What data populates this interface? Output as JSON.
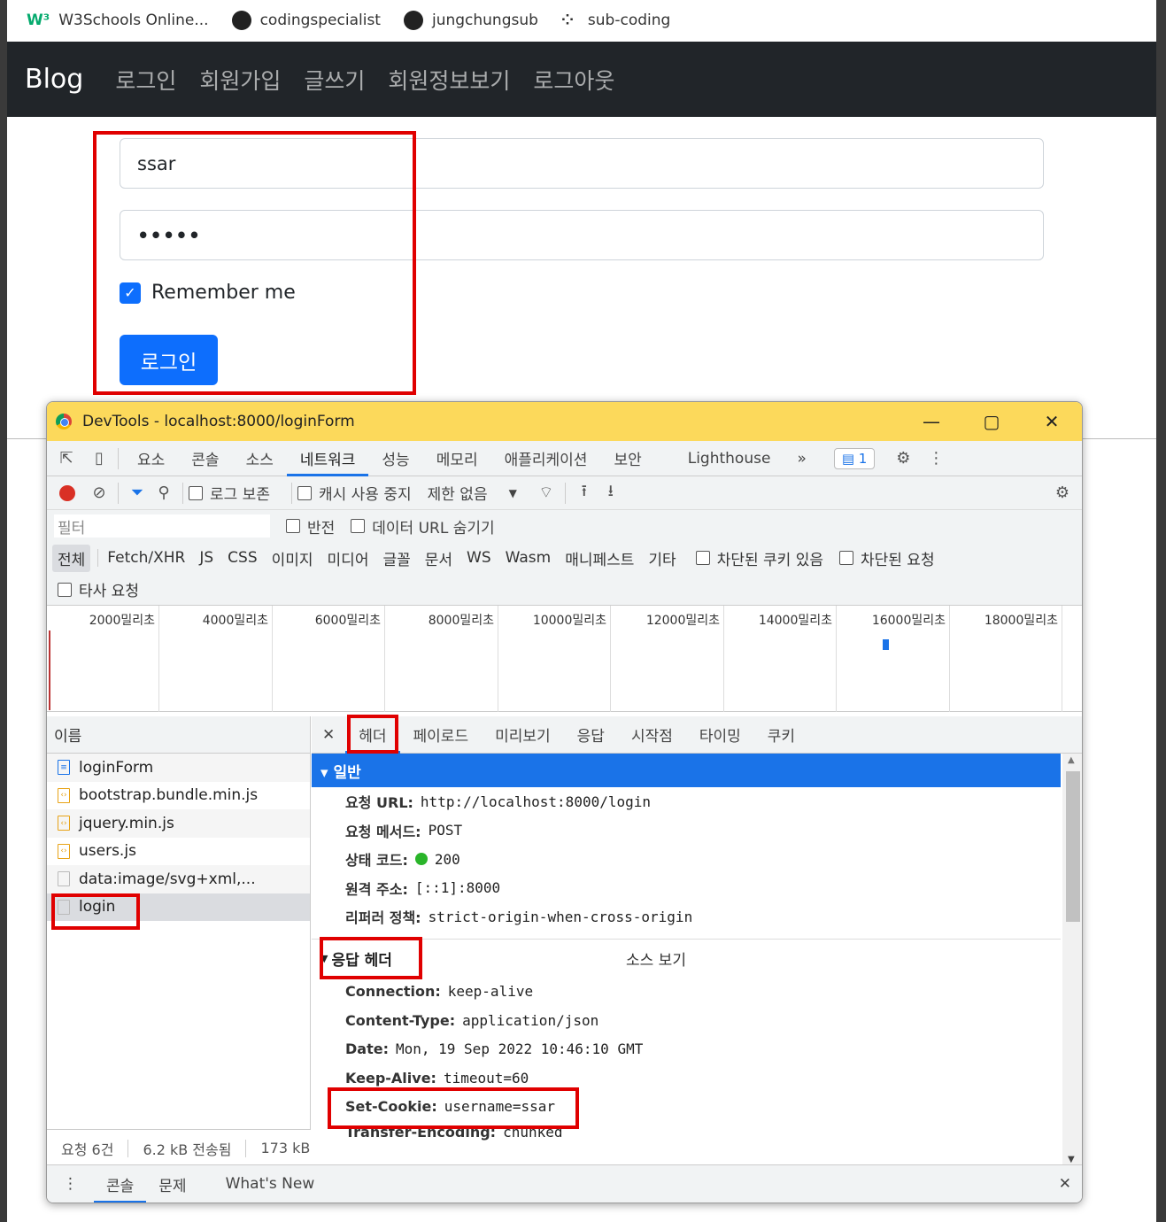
{
  "bookmarks": [
    {
      "label": "W3Schools Online...",
      "icon": "w3schools-icon"
    },
    {
      "label": "codingspecialist",
      "icon": "github-icon"
    },
    {
      "label": "jungchungsub",
      "icon": "github-icon"
    },
    {
      "label": "sub-coding",
      "icon": "linktree-icon"
    }
  ],
  "navbar": {
    "brand": "Blog",
    "links": [
      "로그인",
      "회원가입",
      "글쓰기",
      "회원정보보기",
      "로그아웃"
    ]
  },
  "login_form": {
    "username_value": "ssar",
    "password_value": "•••••",
    "remember_label": "Remember me",
    "remember_checked": true,
    "submit_label": "로그인"
  },
  "devtools": {
    "title": "DevTools - localhost:8000/loginForm",
    "tabs": [
      "요소",
      "콘솔",
      "소스",
      "네트워크",
      "성능",
      "메모리",
      "애플리케이션",
      "보안",
      "Lighthouse"
    ],
    "active_tab": "네트워크",
    "message_count": "1",
    "toolbar": {
      "preserve_log": "로그 보존",
      "disable_cache": "캐시 사용 중지",
      "throttle": "제한 없음"
    },
    "filter": {
      "placeholder": "필터",
      "invert": "반전",
      "hide_data_urls": "데이터 URL 숨기기"
    },
    "types": [
      "전체",
      "Fetch/XHR",
      "JS",
      "CSS",
      "이미지",
      "미디어",
      "글꼴",
      "문서",
      "WS",
      "Wasm",
      "매니페스트",
      "기타"
    ],
    "blocked_cookies": "차단된 쿠키 있음",
    "blocked_requests": "차단된 요청",
    "third_party": "타사 요청",
    "timeline_ticks": [
      "2000밀리초",
      "4000밀리초",
      "6000밀리초",
      "8000밀리초",
      "10000밀리초",
      "12000밀리초",
      "14000밀리초",
      "16000밀리초",
      "18000밀리초"
    ],
    "names_header": "이름",
    "files": [
      {
        "name": "loginForm",
        "type": "doc"
      },
      {
        "name": "bootstrap.bundle.min.js",
        "type": "js"
      },
      {
        "name": "jquery.min.js",
        "type": "js"
      },
      {
        "name": "users.js",
        "type": "js"
      },
      {
        "name": "data:image/svg+xml,...",
        "type": "blank"
      },
      {
        "name": "login",
        "type": "blank"
      }
    ],
    "status": {
      "requests": "요청 6건",
      "transferred": "6.2 kB 전송됨",
      "resources": "173 kB"
    },
    "detail_tabs": [
      "헤더",
      "페이로드",
      "미리보기",
      "응답",
      "시작점",
      "타이밍",
      "쿠키"
    ],
    "general": {
      "title": "▾ 일반",
      "rows": [
        {
          "k": "요청 URL:",
          "v": "http://localhost:8000/login"
        },
        {
          "k": "요청 메서드:",
          "v": "POST"
        },
        {
          "k": "상태 코드:",
          "v": "200"
        },
        {
          "k": "원격 주소:",
          "v": "[::1]:8000"
        },
        {
          "k": "리퍼러 정책:",
          "v": "strict-origin-when-cross-origin"
        }
      ]
    },
    "response_headers": {
      "title": "응답 헤더",
      "view_source": "소스 보기",
      "rows": [
        {
          "k": "Connection:",
          "v": "keep-alive"
        },
        {
          "k": "Content-Type:",
          "v": "application/json"
        },
        {
          "k": "Date:",
          "v": "Mon, 19 Sep 2022 10:46:10 GMT"
        },
        {
          "k": "Keep-Alive:",
          "v": "timeout=60"
        },
        {
          "k": "Set-Cookie:",
          "v": "username=ssar"
        },
        {
          "k": "Transfer-Encoding:",
          "v": "chunked"
        }
      ]
    },
    "bottom_tabs": [
      "콘솔",
      "문제",
      "What's New"
    ]
  },
  "colors": {
    "navbar_bg": "#212529",
    "primary": "#0d6efd",
    "highlight_red": "#e00000",
    "devtools_title_bg": "#fcd95b",
    "devtools_accent": "#1a73e8"
  }
}
